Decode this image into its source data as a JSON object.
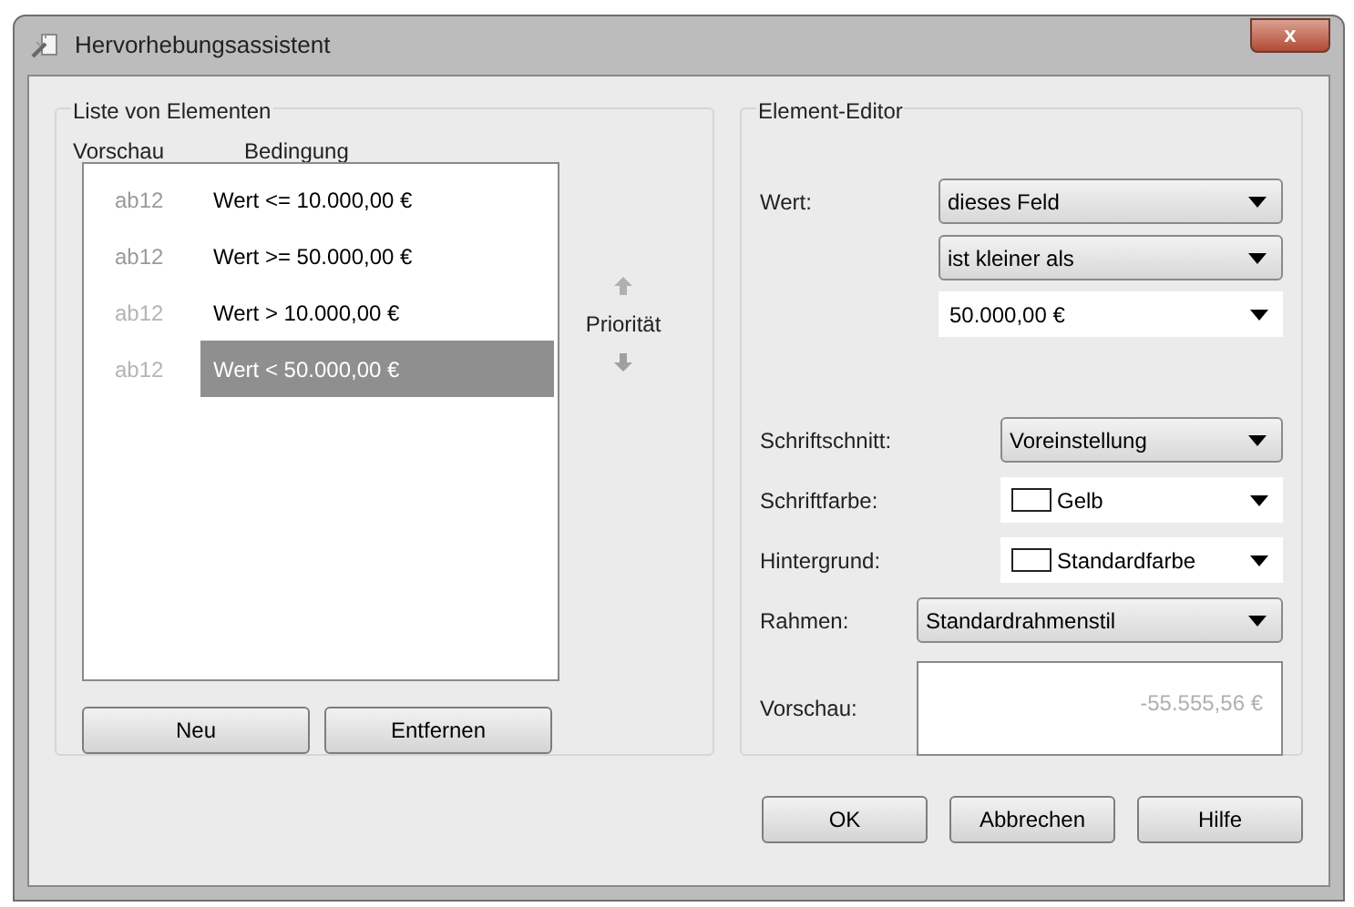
{
  "window": {
    "title": "Hervorhebungsassistent",
    "close_label": "x"
  },
  "list_group": {
    "title": "Liste von Elementen",
    "columns": [
      "Vorschau",
      "Bedingung"
    ],
    "rows": [
      {
        "preview": "ab12",
        "color": "#9a9a9a",
        "condition": "Wert <= 10.000,00 €",
        "selected": false
      },
      {
        "preview": "ab12",
        "color": "#9a9a9a",
        "condition": "Wert >= 50.000,00 €",
        "selected": false
      },
      {
        "preview": "ab12",
        "color": "#b4b4b4",
        "condition": "Wert > 10.000,00 €",
        "selected": false
      },
      {
        "preview": "ab12",
        "color": "#b4b4b4",
        "condition": "Wert < 50.000,00 €",
        "selected": true
      }
    ],
    "buttons": [
      "Neu",
      "Entfernen"
    ]
  },
  "priority": {
    "label": "Priorität"
  },
  "editor": {
    "title": "Element-Editor",
    "groups": [
      {
        "rows": [
          {
            "label": "Wert:",
            "control": {
              "kind": "combo",
              "value": "dieses Feld"
            }
          },
          {
            "control": {
              "kind": "combo",
              "value": "ist kleiner als"
            }
          },
          {
            "control": {
              "kind": "field",
              "value": "50.000,00 €"
            }
          }
        ]
      },
      {
        "rows": [
          {
            "label": "Schriftschnitt:",
            "control": {
              "kind": "combo",
              "value": "Voreinstellung"
            }
          },
          {
            "label": "Schriftfarbe:",
            "control": {
              "kind": "field",
              "value": "Gelb",
              "swatch": true
            }
          },
          {
            "label": "Hintergrund:",
            "control": {
              "kind": "field",
              "value": "Standardfarbe",
              "swatch": true
            }
          },
          {
            "label": "Rahmen:",
            "control": {
              "kind": "combo",
              "value": "Standardrahmenstil"
            }
          }
        ]
      }
    ],
    "preview": {
      "label": "Vorschau:",
      "value": "-55.555,56 €"
    }
  },
  "buttons": [
    "OK",
    "Abbrechen",
    "Hilfe"
  ]
}
